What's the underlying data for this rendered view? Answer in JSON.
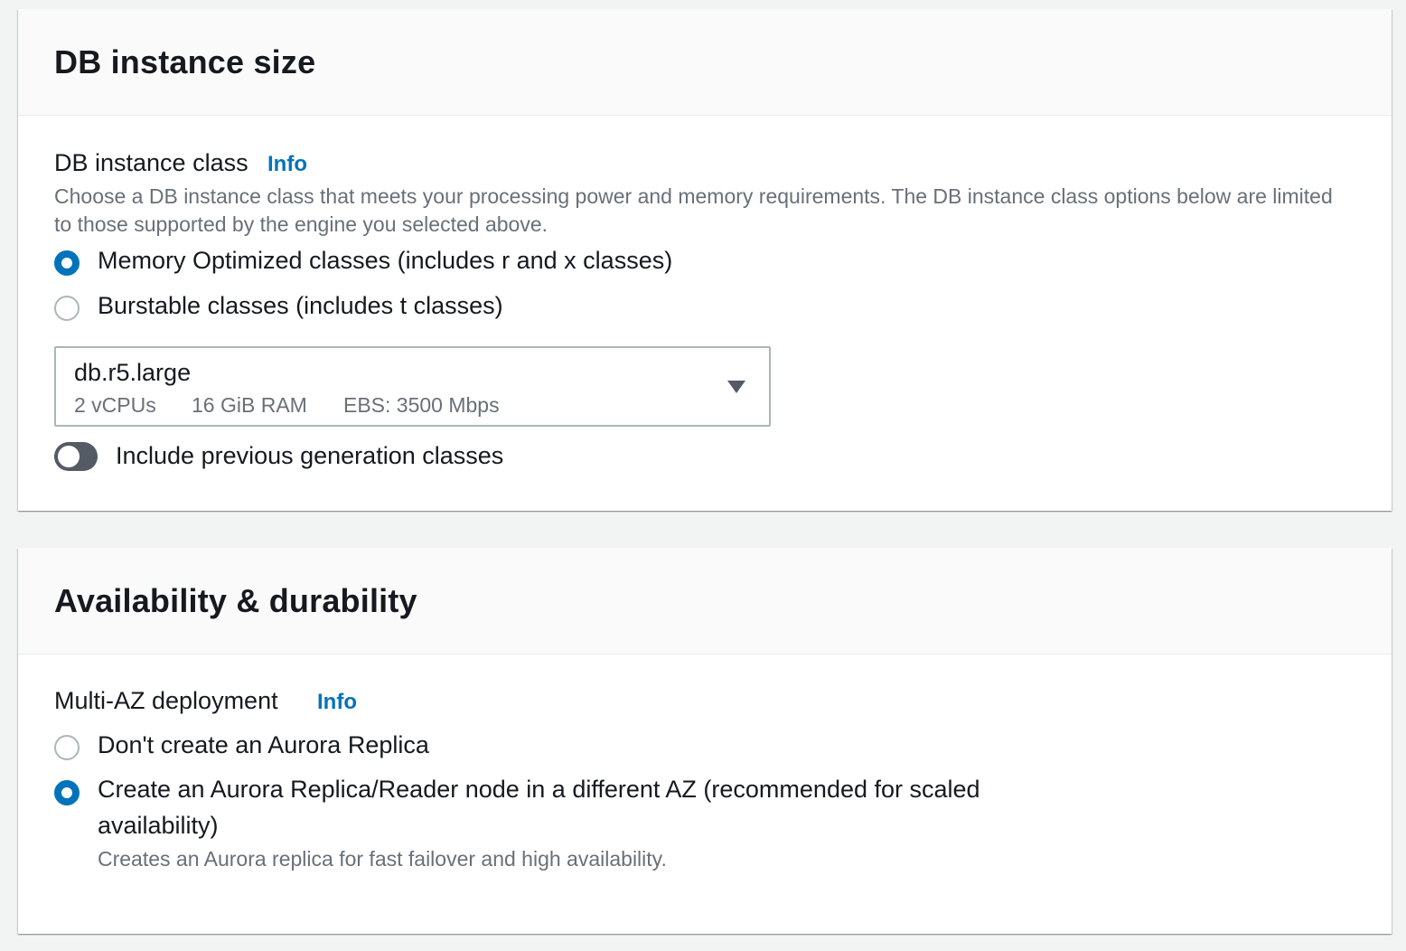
{
  "instance_size": {
    "title": "DB instance size",
    "class_label": "DB instance class",
    "info_link": "Info",
    "description": "Choose a DB instance class that meets your processing power and memory requirements. The DB instance class options below are limited to those supported by the engine you selected above.",
    "class_options": [
      {
        "label": "Memory Optimized classes (includes r and x classes)",
        "checked": true
      },
      {
        "label": "Burstable classes (includes t classes)",
        "checked": false
      }
    ],
    "selected_class": {
      "name": "db.r5.large",
      "vcpus": "2 vCPUs",
      "ram": "16 GiB RAM",
      "ebs": "EBS: 3500 Mbps"
    },
    "previous_gen_toggle": {
      "label": "Include previous generation classes",
      "on": false
    }
  },
  "availability": {
    "title": "Availability & durability",
    "multi_az_label": "Multi-AZ deployment",
    "info_link": "Info",
    "options": [
      {
        "label": "Don't create an Aurora Replica",
        "checked": false
      },
      {
        "label": "Create an Aurora Replica/Reader node in a different AZ (recommended for scaled availability)",
        "checked": true,
        "description": "Creates an Aurora replica for fast failover and high availability."
      }
    ]
  },
  "colors": {
    "accent": "#0073bb",
    "page_bg": "#f2f3f3",
    "header_bg": "#fafafa",
    "muted_text": "#687078",
    "toggle_off": "#545b64"
  }
}
